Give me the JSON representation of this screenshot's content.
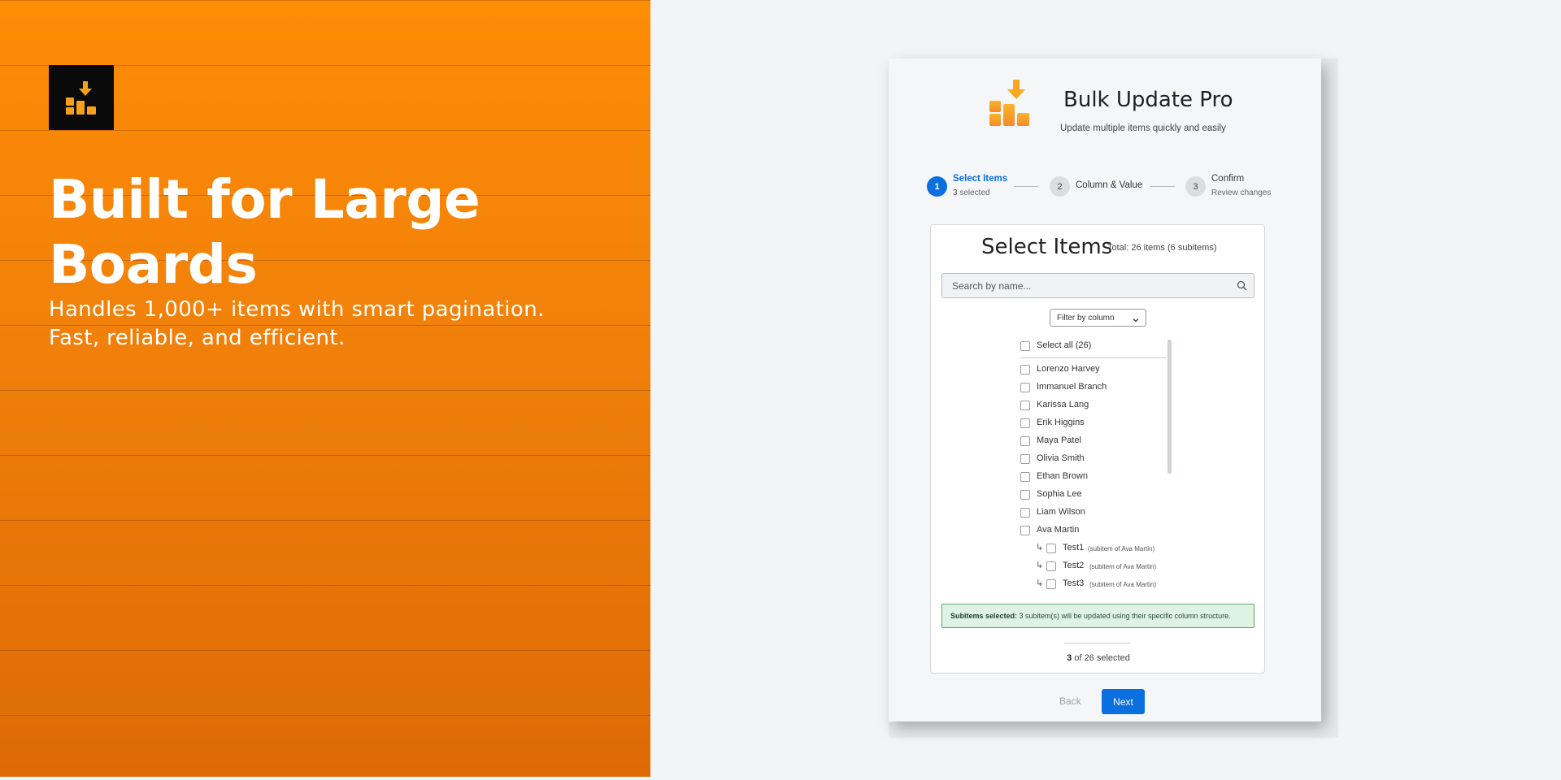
{
  "hero": {
    "title_line1": "Built for Large",
    "title_line2": "Boards",
    "subtitle_line1": "Handles 1,000+ items with smart pagination.",
    "subtitle_line2": "Fast, reliable, and efficient.",
    "logo_icon": "bulk-update-logo-icon"
  },
  "app": {
    "title": "Bulk Update Pro",
    "subtitle": "Update multiple items quickly and easily",
    "steps": [
      {
        "number": "1",
        "title": "Select Items",
        "sub": "3 selected",
        "state": "active"
      },
      {
        "number": "2",
        "title": "Column & Value",
        "sub": "",
        "state": "pending"
      },
      {
        "number": "3",
        "title": "Confirm",
        "sub": "Review changes",
        "state": "pending"
      }
    ],
    "select": {
      "title": "Select Items",
      "total": "Total: 26 items (6 subitems)",
      "search_placeholder": "Search by name...",
      "filter_label": "Filter by column",
      "select_all": "Select all (26)",
      "items": [
        "Lorenzo Harvey",
        "Immanuel Branch",
        "Karissa Lang",
        "Erik Higgins",
        "Maya Patel",
        "Olivia Smith",
        "Ethan Brown",
        "Sophia Lee",
        "Liam Wilson",
        "Ava Martin"
      ],
      "subitems": [
        {
          "name": "Test1",
          "parent": "(subitem of Ava Martin)"
        },
        {
          "name": "Test2",
          "parent": "(subitem of Ava Martin)"
        },
        {
          "name": "Test3",
          "parent": "(subitem of Ava Martin)"
        }
      ],
      "notice_bold": "Subitems selected:",
      "notice_text": " 3 subitem(s) will be updated using their specific column structure.",
      "count_selected": "3",
      "count_suffix": " of 26 selected"
    },
    "buttons": {
      "back": "Back",
      "next": "Next"
    }
  },
  "colors": {
    "accent": "#0b6fe0",
    "hero_orange": "#ff8c05",
    "notice_green": "#dff3e3"
  }
}
